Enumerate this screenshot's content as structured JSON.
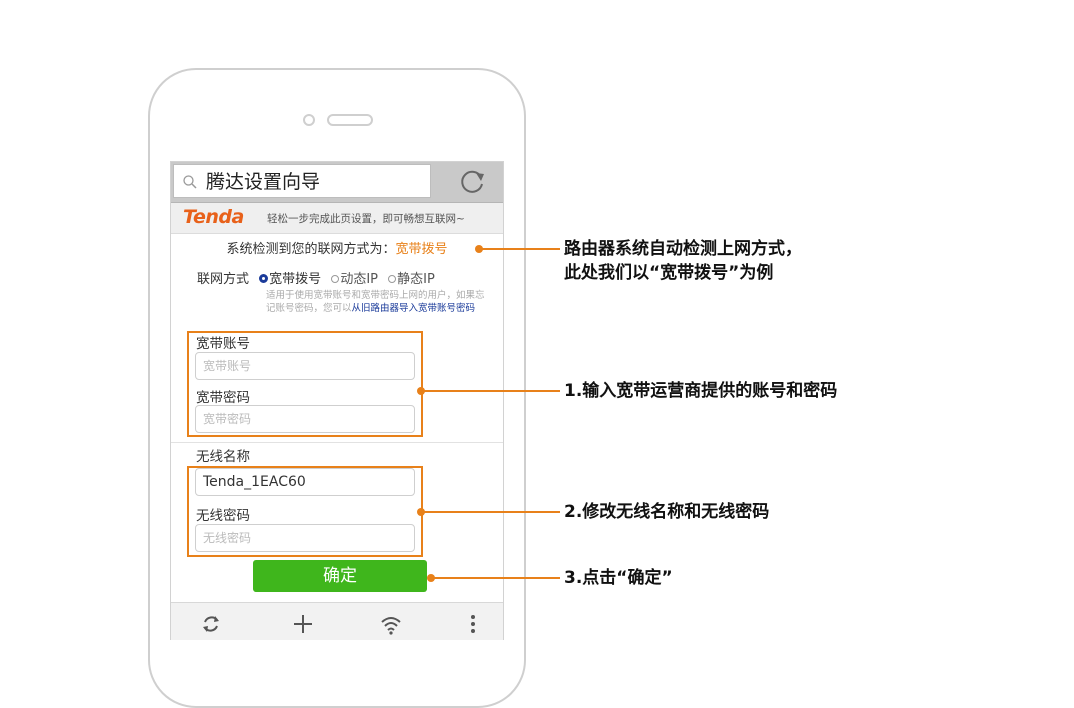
{
  "browser": {
    "title": "腾达设置向导",
    "icons": [
      "search-icon",
      "refresh-icon"
    ]
  },
  "brand": {
    "logo": "Tenda",
    "slogan": "轻松一步完成此页设置，即可畅想互联网~"
  },
  "detect": {
    "label": "系统检测到您的联网方式为：",
    "value": "宽带拨号"
  },
  "connection_mode": {
    "label": "联网方式",
    "options": [
      "宽带拨号",
      "动态IP",
      "静态IP"
    ],
    "selected": "宽带拨号"
  },
  "hint": {
    "text": "适用于使用宽带账号和宽带密码上网的用户，如果忘记账号密码，您可以",
    "link": "从旧路由器导入宽带账号密码"
  },
  "pppoe": {
    "account_label": "宽带账号",
    "account_placeholder": "宽带账号",
    "password_label": "宽带密码",
    "password_placeholder": "宽带密码"
  },
  "wireless": {
    "ssid_label": "无线名称",
    "ssid_value": "Tenda_1EAC60",
    "password_label": "无线密码",
    "password_placeholder": "无线密码"
  },
  "confirm_button": "确定",
  "toolbar_icons": [
    "sync-icon",
    "plus-icon",
    "wifi-icon",
    "more-icon"
  ],
  "callouts": {
    "c0_line1": "路由器系统自动检测上网方式，",
    "c0_line2": "此处我们以“宽带拨号”为例",
    "c1": "1.输入宽带运营商提供的账号和密码",
    "c2": "2.修改无线名称和无线密码",
    "c3": "3.点击“确定”"
  },
  "colors": {
    "accent_orange": "#e8811a",
    "confirm_green": "#3fb61c",
    "radio_blue": "#1b3b9a"
  }
}
